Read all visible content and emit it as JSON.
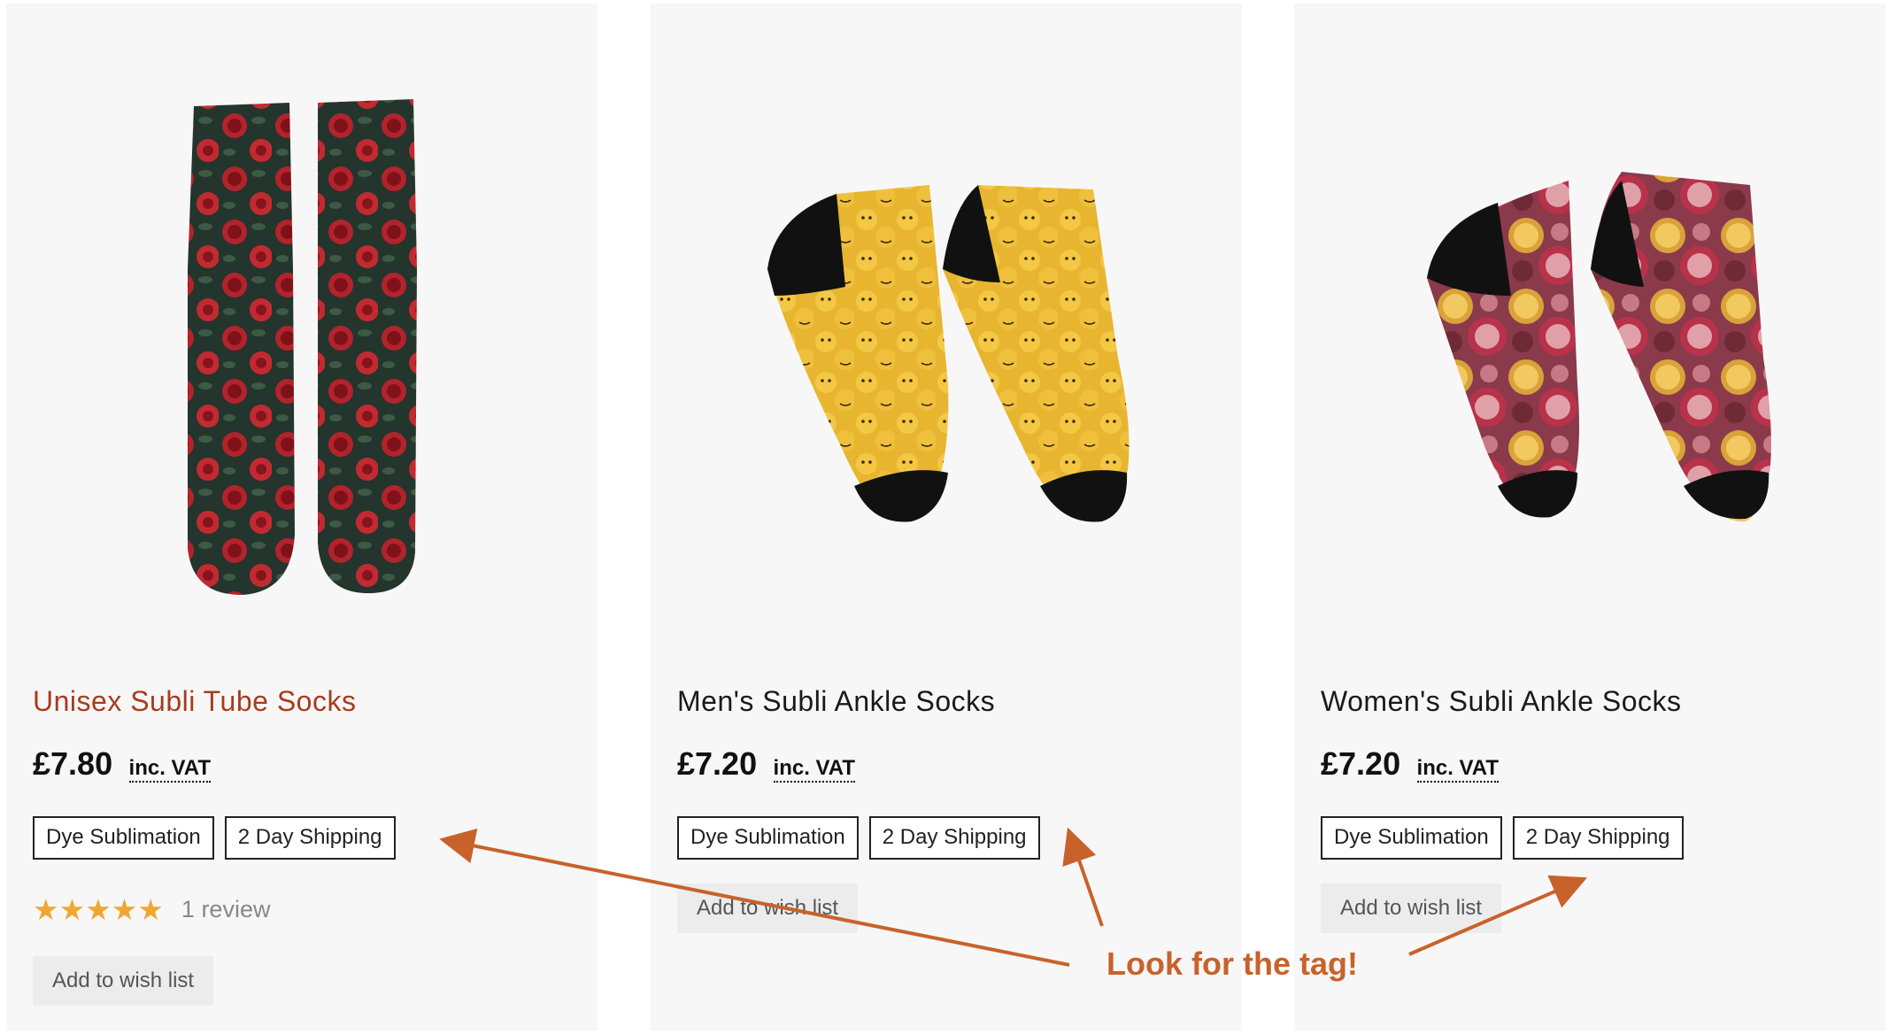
{
  "products": [
    {
      "title": "Unisex Subli Tube Socks",
      "price": "£7.80",
      "vat_label": "inc. VAT",
      "tags": [
        "Dye Sublimation",
        "2 Day Shipping"
      ],
      "rating": {
        "stars": "★★★★★",
        "reviews": "1 review"
      },
      "wish_label": "Add to wish list"
    },
    {
      "title": "Men's Subli Ankle Socks",
      "price": "£7.20",
      "vat_label": "inc. VAT",
      "tags": [
        "Dye Sublimation",
        "2 Day Shipping"
      ],
      "wish_label": "Add to wish list"
    },
    {
      "title": "Women's Subli Ankle Socks",
      "price": "£7.20",
      "vat_label": "inc. VAT",
      "tags": [
        "Dye Sublimation",
        "2 Day Shipping"
      ],
      "wish_label": "Add to wish list"
    }
  ],
  "annotation": {
    "callout": "Look for the tag!"
  },
  "colors": {
    "accent_title": "#a83c1e",
    "annotation": "#c8622a",
    "star": "#f0a732",
    "card_bg": "#f7f7f7"
  },
  "icons": [
    "rose-tube-socks-image",
    "emoji-ankle-socks-image",
    "fruit-ankle-socks-image",
    "star-icon",
    "arrow-icon"
  ]
}
